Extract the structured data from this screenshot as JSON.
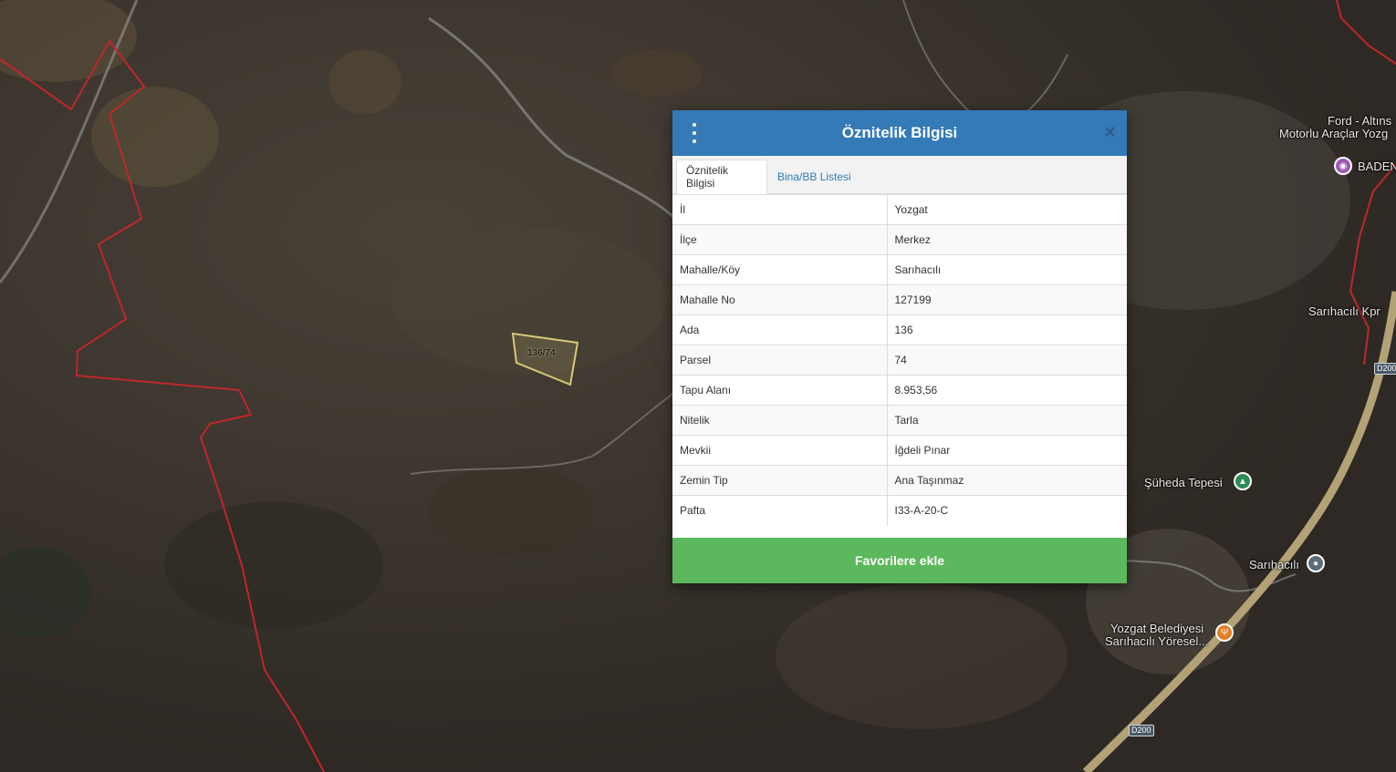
{
  "map": {
    "parcel_label": "136/74",
    "labels": [
      {
        "text": "Ford - Altıns",
        "name": "label-ford"
      },
      {
        "text": "Motorlu Araçlar Yozg",
        "name": "label-motorlu"
      },
      {
        "text": "BADEN",
        "name": "label-baden"
      },
      {
        "text": "Sarıhacılı Kpr",
        "name": "label-kopru"
      },
      {
        "text": "Şüheda Tepesi",
        "name": "label-suheda"
      },
      {
        "text": "Sarıhacılı",
        "name": "label-sarihacili"
      },
      {
        "text": "Yozgat Belediyesi",
        "name": "label-belediye"
      },
      {
        "text": "Sarıhacılı Yöresel...",
        "name": "label-yoresel"
      }
    ],
    "roads": [
      "D200",
      "D200"
    ],
    "colors": {
      "boundary": "#c0262b",
      "parcel": "#d9c878",
      "highway": "#b3a276"
    }
  },
  "dialog": {
    "title": "Öznitelik Bilgisi",
    "tabs": [
      {
        "label": "Öznitelik Bilgisi",
        "active": true
      },
      {
        "label": "Bina/BB Listesi",
        "active": false
      }
    ],
    "rows": [
      {
        "key": "İl",
        "value": "Yozgat"
      },
      {
        "key": "İlçe",
        "value": "Merkez"
      },
      {
        "key": "Mahalle/Köy",
        "value": "Sarıhacılı"
      },
      {
        "key": "Mahalle No",
        "value": "127199"
      },
      {
        "key": "Ada",
        "value": "136"
      },
      {
        "key": "Parsel",
        "value": "74"
      },
      {
        "key": "Tapu Alanı",
        "value": "8.953,56"
      },
      {
        "key": "Nitelik",
        "value": "Tarla"
      },
      {
        "key": "Mevkii",
        "value": "İğdeli Pınar"
      },
      {
        "key": "Zemin Tip",
        "value": "Ana Taşınmaz"
      },
      {
        "key": "Pafta",
        "value": "I33-A-20-C"
      }
    ],
    "favorite_label": "Favorilere ekle",
    "colors": {
      "header": "#337ab7",
      "favorite": "#5cb85c"
    }
  }
}
